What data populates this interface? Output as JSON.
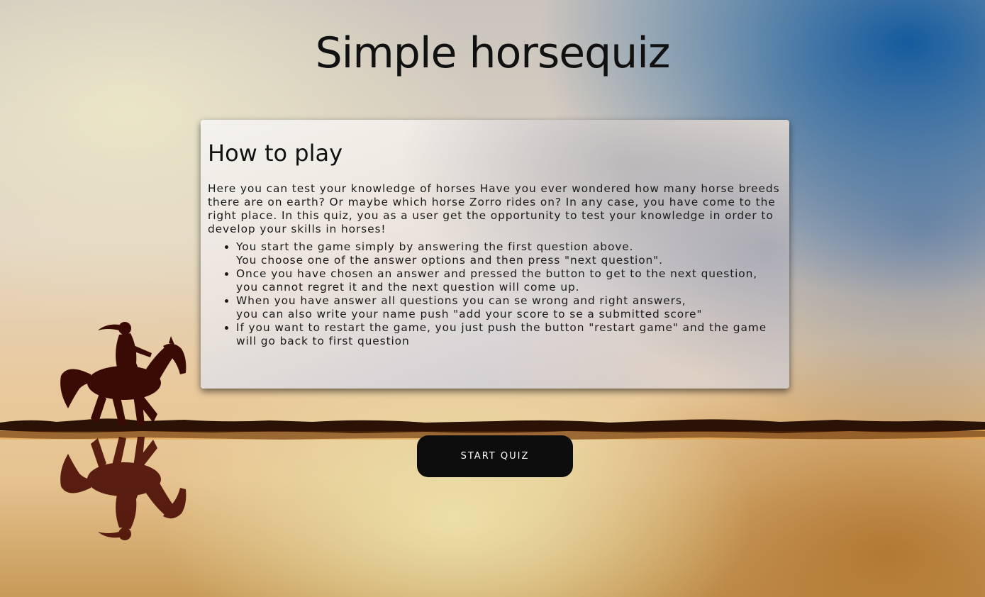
{
  "header": {
    "title": "Simple horsequiz"
  },
  "instructions": {
    "title": "How to play",
    "intro": "Here you can test your knowledge of horses Have you ever wondered how many horse breeds there are on earth? Or maybe which horse Zorro rides on? In any case, you have come to the right place. In this quiz, you as a user get the opportunity to test your knowledge in order to develop your skills in horses!",
    "rules": [
      {
        "line1": "You start the game simply by answering the first question above.",
        "line2": "You choose one of the answer options and then press \"next question\"."
      },
      {
        "line1": "Once you have chosen an answer and pressed the button to get to the next question,",
        "line2": "you cannot regret it and the next question will come up."
      },
      {
        "line1": "When you have answer all questions you can se wrong and right answers,",
        "line2": "you can also write your name push \"add your score to se a submitted score\""
      },
      {
        "line1": "If you want to restart the game, you just push the button \"restart game\" and the game will go back to first question"
      }
    ]
  },
  "actions": {
    "start_label": "START QUIZ"
  },
  "colors": {
    "sky_blue": "#0c569c",
    "horizon_gold": "#e9c99b",
    "silhouette": "#3a0a04",
    "button": "#0d0d0d"
  }
}
